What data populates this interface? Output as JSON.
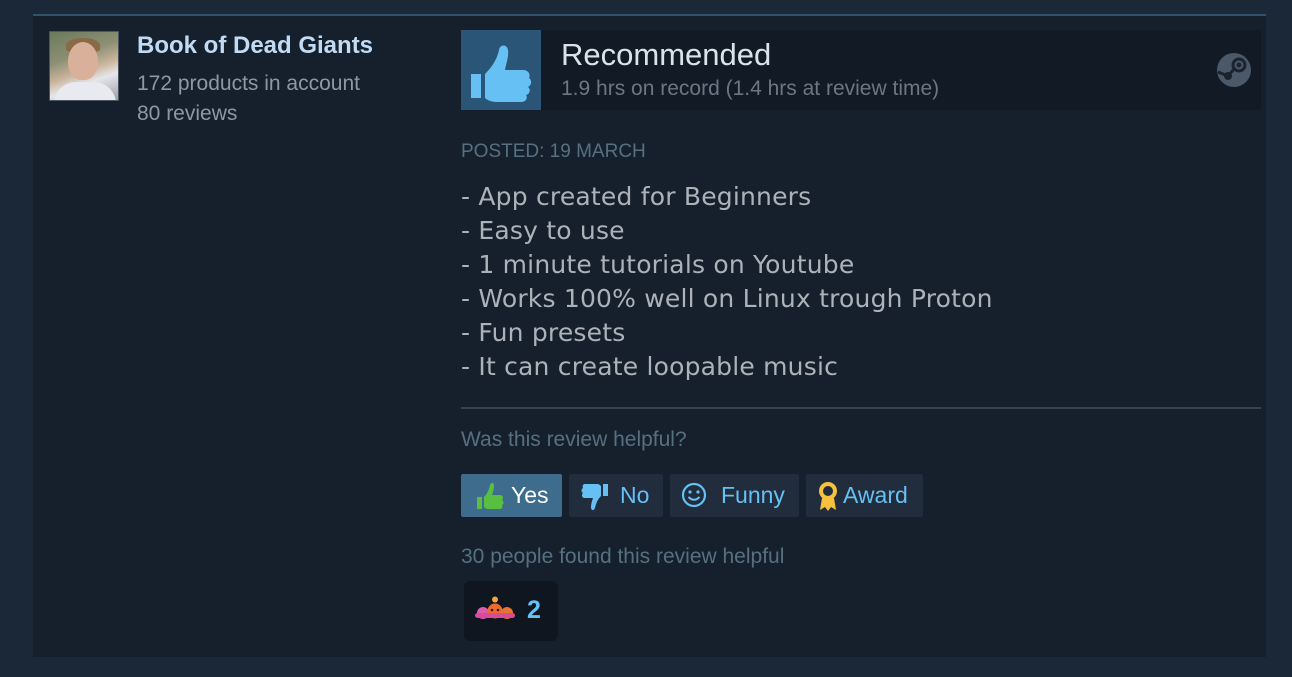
{
  "user": {
    "name": "Book of Dead Giants",
    "products": "172 products in account",
    "reviews": "80 reviews"
  },
  "review": {
    "vote_title": "Recommended",
    "hours": "1.9 hrs on record (1.4 hrs at review time)",
    "posted": "Posted: 19 March",
    "lines": [
      "- App created for Beginners",
      "- Easy to use",
      "- 1 minute tutorials on Youtube",
      "- Works 100% well on Linux trough Proton",
      "- Fun presets",
      "- It can create loopable music"
    ]
  },
  "helpful": {
    "question": "Was this review helpful?",
    "buttons": {
      "yes": "Yes",
      "no": "No",
      "funny": "Funny",
      "award": "Award"
    },
    "found_text": "30 people found this review helpful",
    "award_count": "2"
  },
  "icons": {
    "vote": "thumbs-up-icon",
    "platform": "steam-logo-icon",
    "yes": "thumbs-up-icon",
    "no": "thumbs-down-icon",
    "funny": "smiley-icon",
    "award": "award-ribbon-icon",
    "reaction": "reaction-award-icon"
  },
  "colors": {
    "accent": "#66c0f4",
    "yes_button": "#3d6c8d",
    "card_bg": "#16202d"
  }
}
